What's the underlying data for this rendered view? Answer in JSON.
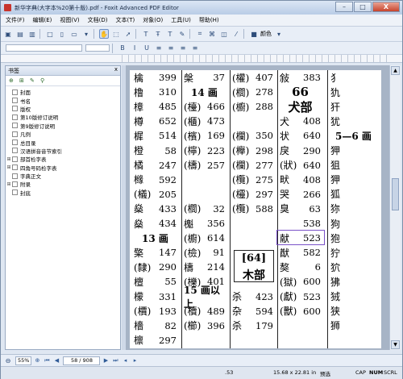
{
  "window": {
    "title": "新华字典(大字本%20第十版).pdf - Foxit Advanced PDF Editor",
    "min": "–",
    "max": "□",
    "close": "X"
  },
  "menu": [
    "文件(F)",
    "编辑(E)",
    "视图(V)",
    "文档(D)",
    "文本(T)",
    "对象(O)",
    "工具(U)",
    "帮助(H)"
  ],
  "toolbar": {
    "color_label": "颜色"
  },
  "panel": {
    "title": "书签",
    "close": "x"
  },
  "bookmarks": [
    {
      "label": "封面",
      "expandable": false
    },
    {
      "label": "书名",
      "expandable": false
    },
    {
      "label": "版权",
      "expandable": false
    },
    {
      "label": "第10版修订说明",
      "expandable": false
    },
    {
      "label": "第9版修订说明",
      "expandable": false
    },
    {
      "label": "凡例",
      "expandable": false
    },
    {
      "label": "总目录",
      "expandable": false
    },
    {
      "label": "汉语拼音音节索引",
      "expandable": false
    },
    {
      "label": "部首检字表",
      "expandable": true
    },
    {
      "label": "四角号码检字表",
      "expandable": true
    },
    {
      "label": "字典正文",
      "expandable": false
    },
    {
      "label": "附录",
      "expandable": true
    },
    {
      "label": "封底",
      "expandable": false
    }
  ],
  "page_content": {
    "col1": [
      [
        "檎",
        "399"
      ],
      [
        "橹",
        "310"
      ],
      [
        "樟",
        "485"
      ],
      [
        "樽",
        "652"
      ],
      [
        "樨",
        "514"
      ],
      [
        "橙",
        "58"
      ],
      [
        "橘",
        "247"
      ],
      [
        "橼",
        "592"
      ],
      [
        "(檥)",
        "205"
      ],
      [
        "燊",
        "433"
      ],
      [
        "燊",
        "434"
      ],
      [
        "13 画",
        ""
      ],
      [
        "檠",
        "147"
      ],
      [
        "(隸)",
        "290"
      ],
      [
        "檀",
        "55"
      ],
      [
        "檬",
        "331"
      ],
      [
        "(檟)",
        "193"
      ],
      [
        "檣",
        "82"
      ],
      [
        "檩",
        "297"
      ]
    ],
    "col2": [
      [
        "槃",
        "37"
      ],
      [
        "14 画",
        ""
      ],
      [
        "(檯)",
        "466"
      ],
      [
        "(櫃)",
        "473"
      ],
      [
        "(檳)",
        "169"
      ],
      [
        "(檸)",
        "223"
      ],
      [
        "(檮)",
        "257"
      ],
      [
        "",
        ""
      ],
      [
        "",
        ""
      ],
      [
        "(櫚)",
        "32"
      ],
      [
        "櫆",
        "356"
      ],
      [
        "(櫥)",
        "614"
      ],
      [
        "(檢)",
        "91"
      ],
      [
        "檮",
        "214"
      ],
      [
        "(櫟)",
        "401"
      ],
      [
        "15 画以上",
        ""
      ],
      [
        "(櫝)",
        "489"
      ],
      [
        "(櫛)",
        "396"
      ],
      [
        "",
        ""
      ]
    ],
    "col3": [
      [
        "(權)",
        "407"
      ],
      [
        "(櫚)",
        "278"
      ],
      [
        "(櫥)",
        "288"
      ],
      [
        "",
        ""
      ],
      [
        "(欄)",
        "350"
      ],
      [
        "(櫸)",
        "298"
      ],
      [
        "(欄)",
        "277"
      ],
      [
        "(欖)",
        "275"
      ],
      [
        "(欞)",
        "297"
      ],
      [
        "(欖)",
        "588"
      ],
      [
        "",
        ""
      ],
      [
        "",
        ""
      ],
      [
        "",
        ""
      ],
      [
        "",
        ""
      ],
      [
        "",
        ""
      ],
      [
        "杀",
        "423"
      ],
      [
        "杂",
        "594"
      ],
      [
        "杀",
        "179"
      ],
      [
        "",
        ""
      ]
    ],
    "col4": [
      [
        "敍",
        "383"
      ],
      [
        "66",
        ""
      ],
      [
        "犬部",
        ""
      ],
      [
        "犬",
        "408"
      ],
      [
        "状",
        "640"
      ],
      [
        "戾",
        "290"
      ],
      [
        "(狀)",
        "640"
      ],
      [
        "畎",
        "408"
      ],
      [
        "哭",
        "266"
      ],
      [
        "臭",
        "63"
      ],
      [
        "",
        "538"
      ],
      [
        "献",
        "523"
      ],
      [
        "猷",
        "582"
      ],
      [
        "獒",
        "6"
      ],
      [
        "(獄)",
        "600"
      ],
      [
        "(獻)",
        "523"
      ],
      [
        "(獸)",
        "600"
      ],
      [
        "",
        ""
      ],
      [
        "",
        ""
      ]
    ],
    "col5": [
      [
        "犭",
        ""
      ],
      [
        "犰",
        ""
      ],
      [
        "犴",
        ""
      ],
      [
        "犹",
        ""
      ],
      [
        "5—6 画",
        ""
      ],
      [
        "狎",
        ""
      ],
      [
        "狙",
        ""
      ],
      [
        "狎",
        ""
      ],
      [
        "狐",
        ""
      ],
      [
        "狝",
        ""
      ],
      [
        "狗",
        ""
      ],
      [
        "狍",
        ""
      ],
      [
        "狞",
        ""
      ],
      [
        "狖",
        ""
      ],
      [
        "狒",
        ""
      ],
      [
        "狨",
        ""
      ],
      [
        "狭",
        ""
      ],
      [
        "狮",
        ""
      ],
      [
        "",
        ""
      ]
    ],
    "box_head": {
      "num": "[64]",
      "name": "木部"
    }
  },
  "navbar": {
    "zoom": "55%",
    "page": "58 / 908"
  },
  "status": {
    "coords": ".53",
    "size": "15.68 x 22.81 in",
    "mode": "预选",
    "caps": "CAP",
    "num": "NUM",
    "scrl": "SCRL"
  }
}
